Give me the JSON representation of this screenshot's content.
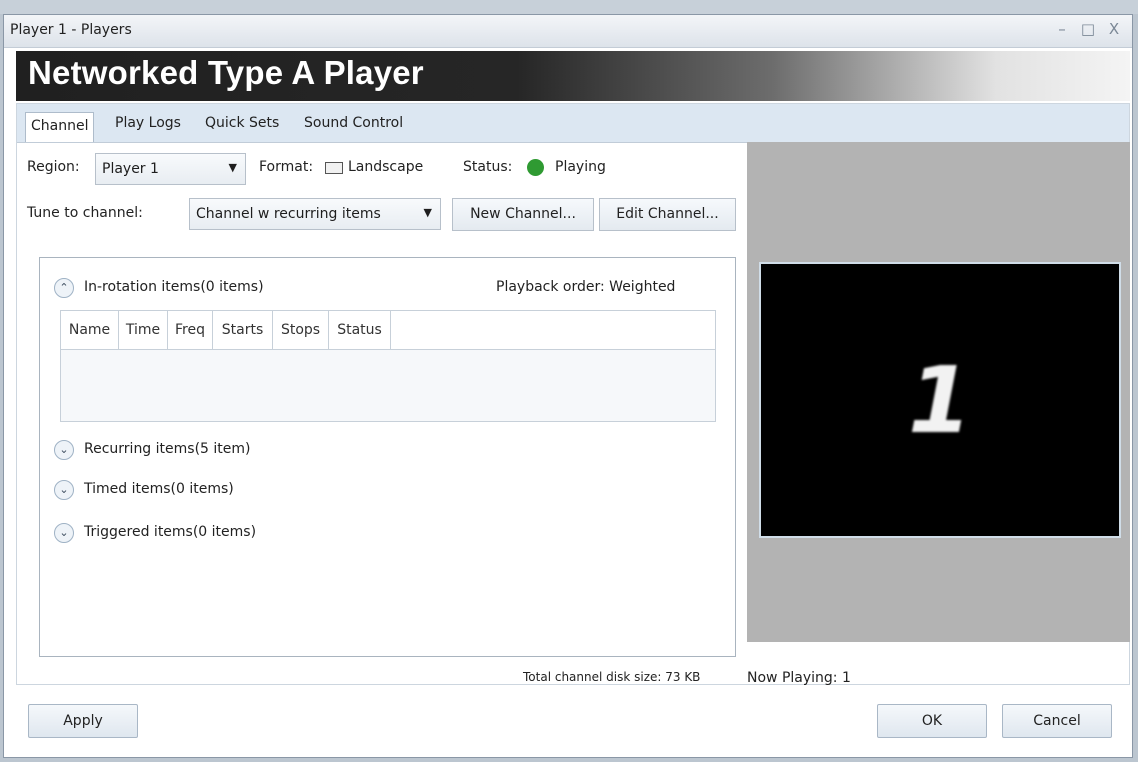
{
  "window": {
    "title": "Player 1 - Players",
    "minimize_glyph": "–",
    "maximize_glyph": "□",
    "close_glyph": "X"
  },
  "banner": {
    "title": "Networked Type A Player"
  },
  "tabs": [
    {
      "label": "Channel",
      "active": true
    },
    {
      "label": "Play Logs"
    },
    {
      "label": "Quick Sets"
    },
    {
      "label": "Sound Control"
    }
  ],
  "region": {
    "label": "Region:",
    "value": "Player 1",
    "arrow": "▼"
  },
  "format": {
    "label": "Format:",
    "value": "Landscape"
  },
  "status": {
    "label": "Status:",
    "value": "Playing",
    "color": "#2f9a32"
  },
  "tune": {
    "label": "Tune to channel:",
    "value": "Channel w recurring items",
    "arrow": "▼"
  },
  "buttons": {
    "new_channel": "New Channel...",
    "edit_channel": "Edit Channel..."
  },
  "sections": {
    "in_rotation": {
      "label": "In-rotation items(0 items)",
      "toggle": "⌃",
      "playback_order": "Playback order: Weighted"
    },
    "recurring": {
      "label": "Recurring items(5 item)",
      "toggle": "⌄"
    },
    "timed": {
      "label": "Timed items(0 items)",
      "toggle": "⌄"
    },
    "triggered": {
      "label": "Triggered items(0 items)",
      "toggle": "⌄"
    }
  },
  "grid_columns": [
    "Name",
    "Time",
    "Freq",
    "Starts",
    "Stops",
    "Status"
  ],
  "disk_size": "Total channel disk size: 73 KB",
  "preview": {
    "content": "1",
    "now_playing": "Now Playing: 1"
  },
  "footer": {
    "apply": "Apply",
    "ok": "OK",
    "cancel": "Cancel"
  }
}
